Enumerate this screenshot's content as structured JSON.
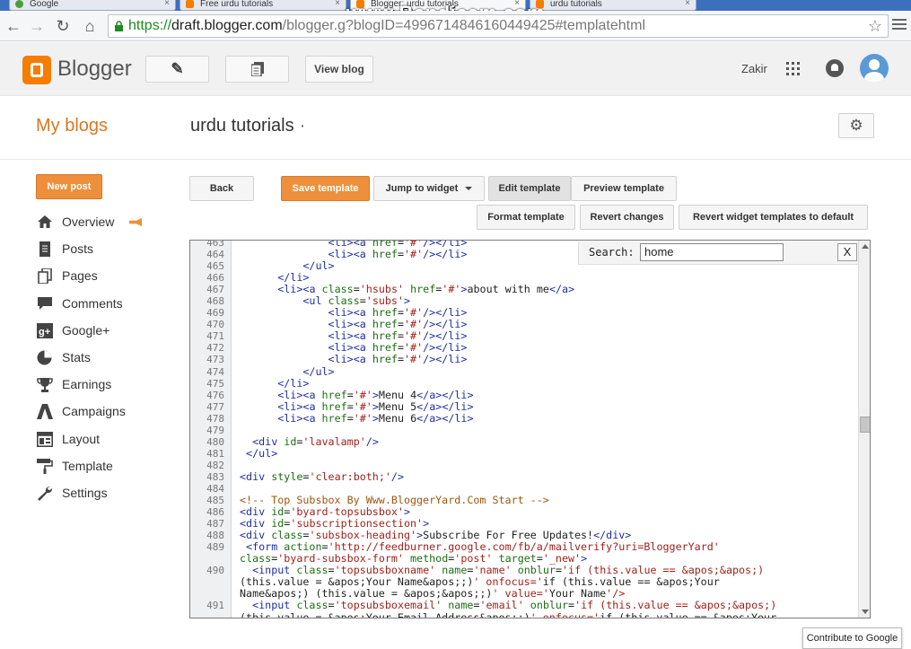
{
  "browser": {
    "tabs": [
      {
        "label": "Google"
      },
      {
        "label": "Free urdu tutorials"
      },
      {
        "label": "Blogger: urdu tutorials"
      },
      {
        "label": "urdu tutorials"
      }
    ],
    "watermark": "www.Bandicam.com",
    "url": {
      "scheme": "https://",
      "host": "draft.blogger.com",
      "path": "/blogger.g?blogID=4996714846160449425#templatehtml"
    }
  },
  "header": {
    "app_name": "Blogger",
    "view_blog": "View blog",
    "user_name": "Zakir"
  },
  "subheader": {
    "my_blogs": "My blogs",
    "blog_title": "urdu tutorials",
    "title_dot": "·"
  },
  "sidebar": {
    "new_post": "New post",
    "items": [
      {
        "label": "Overview",
        "icon": "home-icon"
      },
      {
        "label": "Posts",
        "icon": "posts-icon"
      },
      {
        "label": "Pages",
        "icon": "pages-icon"
      },
      {
        "label": "Comments",
        "icon": "comments-icon"
      },
      {
        "label": "Google+",
        "icon": "google-plus-icon"
      },
      {
        "label": "Stats",
        "icon": "stats-icon"
      },
      {
        "label": "Earnings",
        "icon": "earnings-icon"
      },
      {
        "label": "Campaigns",
        "icon": "campaigns-icon"
      },
      {
        "label": "Layout",
        "icon": "layout-icon"
      },
      {
        "label": "Template",
        "icon": "template-icon"
      },
      {
        "label": "Settings",
        "icon": "settings-icon"
      }
    ]
  },
  "editor_toolbar": {
    "back": "Back",
    "save": "Save template",
    "jump": "Jump to widget",
    "edit": "Edit template",
    "preview": "Preview template",
    "format": "Format template",
    "revert": "Revert changes",
    "revert_widgets": "Revert widget templates to default"
  },
  "search": {
    "label": "Search:",
    "value": "home",
    "close": "X"
  },
  "code_lines": [
    {
      "n": "463",
      "code": "              <li><a href='#'/></li>"
    },
    {
      "n": "464",
      "code": "              <li><a href='#'/></li>"
    },
    {
      "n": "465",
      "code": "          </ul>"
    },
    {
      "n": "466",
      "code": "      </li>"
    },
    {
      "n": "467",
      "code": "      <li><a class='hsubs' href='#'>about with me</a>"
    },
    {
      "n": "468",
      "code": "          <ul class='subs'>"
    },
    {
      "n": "469",
      "code": "              <li><a href='#'/></li>"
    },
    {
      "n": "470",
      "code": "              <li><a href='#'/></li>"
    },
    {
      "n": "471",
      "code": "              <li><a href='#'/></li>"
    },
    {
      "n": "472",
      "code": "              <li><a href='#'/></li>"
    },
    {
      "n": "473",
      "code": "              <li><a href='#'/></li>"
    },
    {
      "n": "474",
      "code": "          </ul>"
    },
    {
      "n": "475",
      "code": "      </li>"
    },
    {
      "n": "476",
      "code": "      <li><a href='#'>Menu 4</a></li>"
    },
    {
      "n": "477",
      "code": "      <li><a href='#'>Menu 5</a></li>"
    },
    {
      "n": "478",
      "code": "      <li><a href='#'>Menu 6</a></li>"
    },
    {
      "n": "479",
      "code": ""
    },
    {
      "n": "480",
      "code": "  <div id='lavalamp'/>"
    },
    {
      "n": "481",
      "code": " </ul>"
    },
    {
      "n": "482",
      "code": ""
    },
    {
      "n": "483",
      "code": "<div style='clear:both;'/>"
    },
    {
      "n": "484",
      "code": ""
    },
    {
      "n": "485",
      "code": "<!-- Top Subsbox By Www.BloggerYard.Com Start -->"
    },
    {
      "n": "486",
      "code": "<div id='byard-topsubsbox'>"
    },
    {
      "n": "487",
      "code": "<div id='subscriptionsection'>"
    },
    {
      "n": "488",
      "code": "<div class='subsbox-heading'>Subscribe For Free Updates!</div>"
    },
    {
      "n": "489",
      "code": " <form action='http://feedburner.google.com/fb/a/mailverify?uri=BloggerYard'\nclass='byard-subsbox-form' method='post' target='_new'>"
    },
    {
      "n": "490",
      "code": "  <input class='topsubsboxname' name='name' onblur='if (this.value == &apos;&apos;)\n(this.value = &apos;Your Name&apos;;)' onfocus='if (this.value == &apos;Your\nName&apos;) (this.value = &apos;&apos;;)' value='Your Name'/>"
    },
    {
      "n": "491",
      "code": "  <input class='topsubsboxemail' name='email' onblur='if (this.value == &apos;&apos;)\n(this.value = &apos;Your Email Address&apos;;)' onfocus='if (this.value == &apos;Your"
    }
  ],
  "translate_button": "Contribute to Google"
}
